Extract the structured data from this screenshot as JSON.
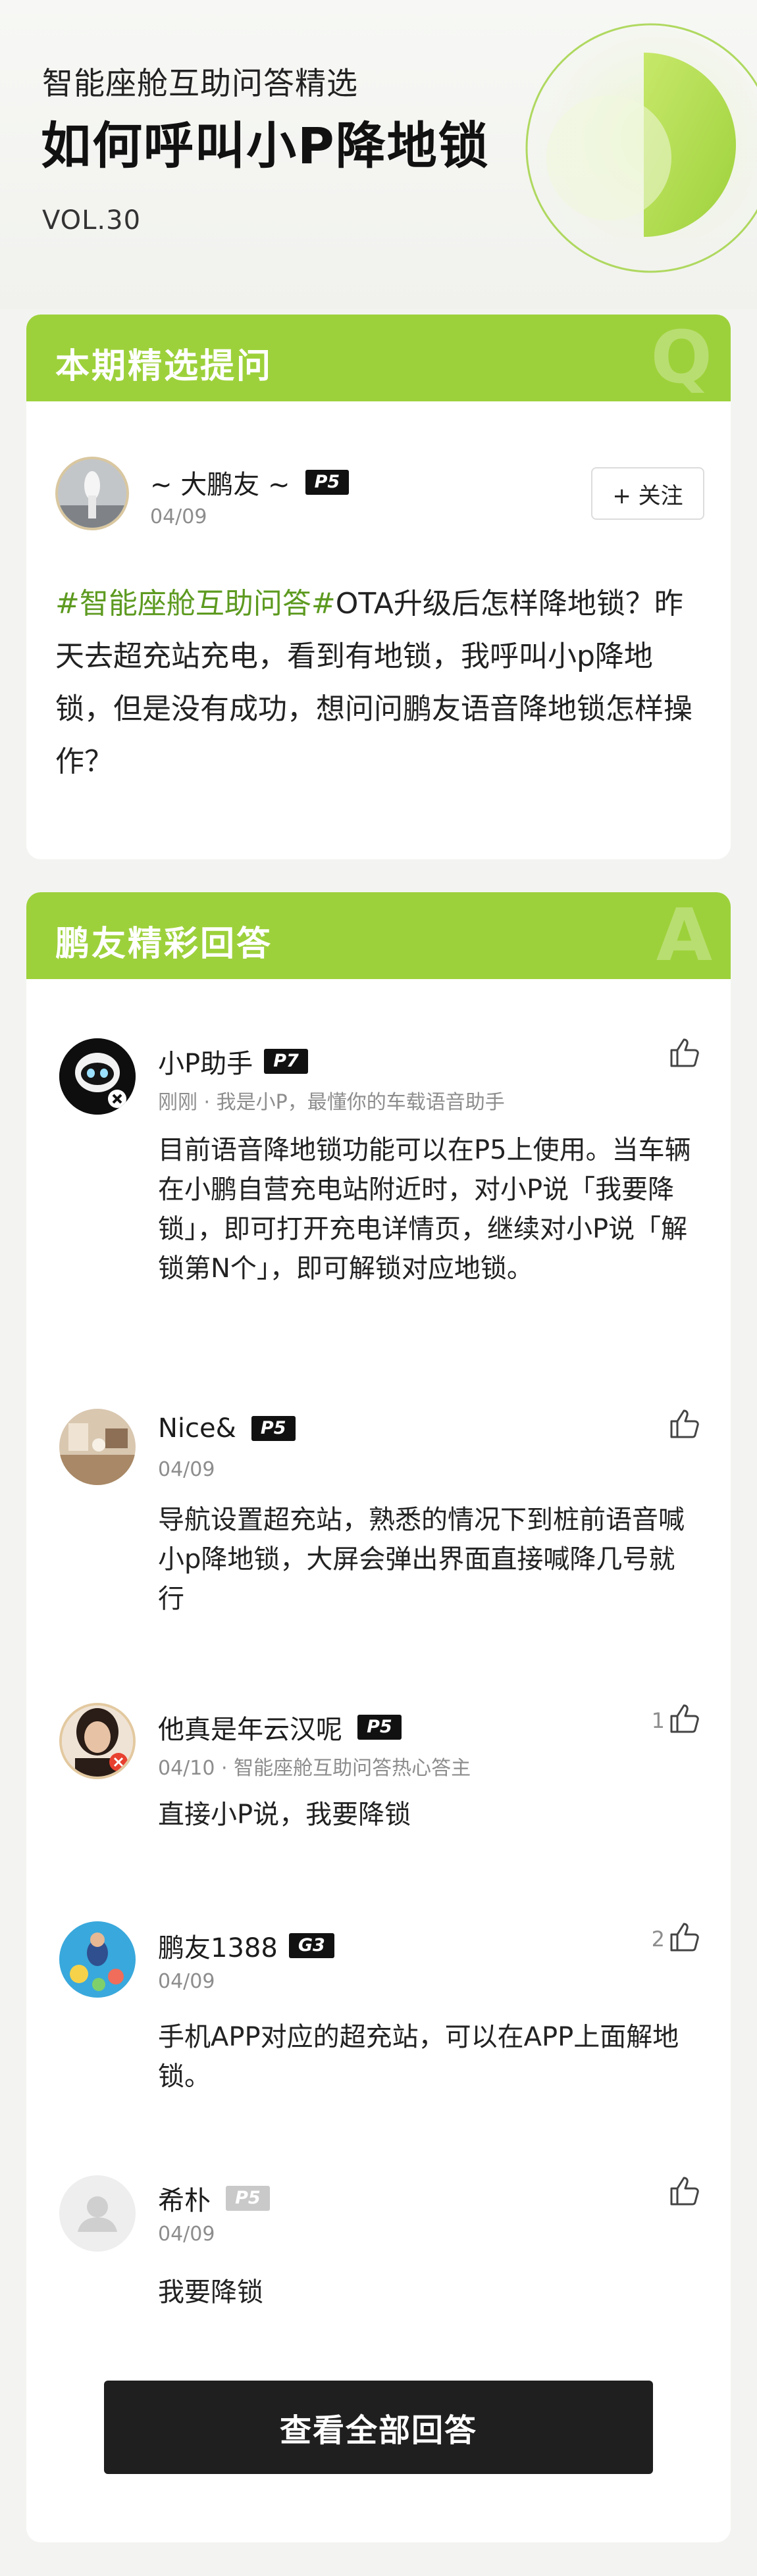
{
  "header": {
    "subtitle": "智能座舱互助问答精选",
    "title": "如何呼叫小P降地锁",
    "vol": "VOL.30"
  },
  "question_card": {
    "heading": "本期精选提问",
    "letter": "Q",
    "user": {
      "name": "~ 大鹏友 ~",
      "level": "P5",
      "date": "04/09"
    },
    "follow_label": "+ 关注",
    "topic": "#智能座舱互助问答#",
    "body": "OTA升级后怎样降地锁？昨天去超充站充电，看到有地锁，我呼叫小p降地锁，但是没有成功，想问问鹏友语音降地锁怎样操作？"
  },
  "answer_card": {
    "heading": "鹏友精彩回答",
    "letter": "A",
    "answers": [
      {
        "name": "小P助手",
        "level": "P7",
        "meta": "刚刚 · 我是小P，最懂你的车载语音助手",
        "text": "目前语音降地锁功能可以在P5上使用。当车辆在小鹏自营充电站附近时，对小P说「我要降锁」，即可打开充电详情页，继续对小P说「解锁第N个」，即可解锁对应地锁。",
        "likes": "",
        "avatar": "robot-avatar"
      },
      {
        "name": "Nice&",
        "level": "P5",
        "meta": "04/09",
        "text": "导航设置超充站，熟悉的情况下到桩前语音喊小p降地锁，大屏会弹出界面直接喊降几号就行",
        "likes": "",
        "avatar": "room-photo-avatar"
      },
      {
        "name": "他真是年云汉呢",
        "level": "P5",
        "meta": "04/10 · 智能座舱互助问答热心答主",
        "text": "直接小P说，我要降锁",
        "likes": "1",
        "avatar": "woman-photo-avatar"
      },
      {
        "name": "鹏友1388",
        "level": "G3",
        "meta": "04/09",
        "text": "手机APP对应的超充站，可以在APP上面解地锁。",
        "likes": "2",
        "avatar": "pool-photo-avatar"
      },
      {
        "name": "希朴",
        "level": "P5",
        "meta": "04/09",
        "text": "我要降锁",
        "likes": "",
        "avatar": "default-person-avatar"
      }
    ],
    "view_all_label": "查看全部回答"
  },
  "colors": {
    "accent_green": "#9dd13b",
    "topic_green": "#5d9a20",
    "button_dark": "#1f1f1f"
  }
}
